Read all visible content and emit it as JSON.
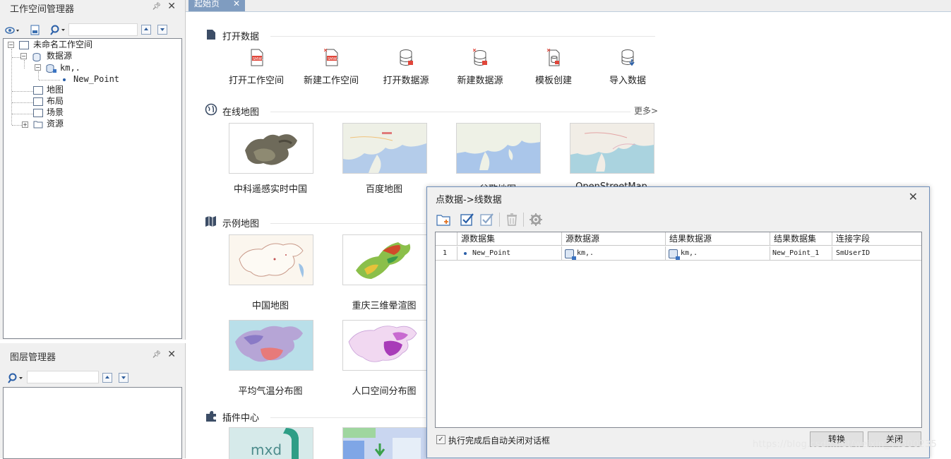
{
  "workspace_panel": {
    "title": "工作空间管理器",
    "tree": {
      "root": "未命名工作空间",
      "datasources": "数据源",
      "datasource_name": "km,.",
      "dataset_name": "New_Point",
      "maps": "地图",
      "layouts": "布局",
      "scenes": "场景",
      "resources": "资源"
    }
  },
  "layer_panel": {
    "title": "图层管理器"
  },
  "tabs": [
    {
      "label": "起始页"
    }
  ],
  "start_page": {
    "open_data": {
      "title": "打开数据",
      "items": [
        {
          "label": "打开工作空间",
          "icon": "open-workspace-icon"
        },
        {
          "label": "新建工作空间",
          "icon": "new-workspace-icon"
        },
        {
          "label": "打开数据源",
          "icon": "open-datasource-icon"
        },
        {
          "label": "新建数据源",
          "icon": "new-datasource-icon"
        },
        {
          "label": "模板创建",
          "icon": "template-icon"
        },
        {
          "label": "导入数据",
          "icon": "import-data-icon"
        }
      ]
    },
    "online_maps": {
      "title": "在线地图",
      "more": "更多>",
      "items": [
        {
          "label": "中科遥感实时中国"
        },
        {
          "label": "百度地图"
        },
        {
          "label": "谷歌地图"
        },
        {
          "label": "OpenStreetMap"
        }
      ]
    },
    "sample_maps": {
      "title": "示例地图",
      "items": [
        {
          "label": "中国地图"
        },
        {
          "label": "重庆三维晕渲图"
        },
        {
          "label": "平均气温分布图"
        },
        {
          "label": "人口空间分布图"
        }
      ]
    },
    "plugin_center": {
      "title": "插件中心",
      "thumb_text": "mxd"
    }
  },
  "dialog": {
    "title": "点数据->线数据",
    "columns": [
      "源数据集",
      "源数据源",
      "结果数据源",
      "结果数据集",
      "连接字段"
    ],
    "rows": [
      {
        "index": "1",
        "source_dataset": "New_Point",
        "source_datasource": "km,.",
        "result_datasource": "km,.",
        "result_dataset": "New_Point_1",
        "link_field": "SmUserID"
      }
    ],
    "auto_close_label": "执行完成后自动关闭对话框",
    "auto_close_checked": true,
    "convert_button": "转换",
    "close_button": "关闭"
  },
  "watermark": "https://blog.csdn.net/weixin_44300235"
}
